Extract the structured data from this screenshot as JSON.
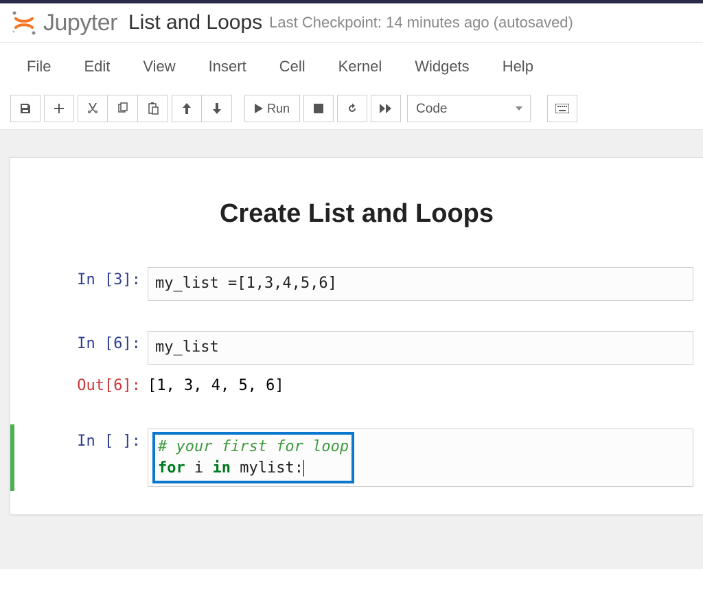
{
  "header": {
    "logo_text": "Jupyter",
    "notebook_title": "List and Loops",
    "checkpoint": "Last Checkpoint: 14 minutes ago  (autosaved)"
  },
  "menubar": {
    "items": [
      "File",
      "Edit",
      "View",
      "Insert",
      "Cell",
      "Kernel",
      "Widgets",
      "Help"
    ]
  },
  "toolbar": {
    "run_label": "Run",
    "celltype": "Code"
  },
  "content": {
    "heading": "Create List and Loops",
    "cell1": {
      "prompt": "In [3]:",
      "code": "my_list =[1,3,4,5,6]"
    },
    "cell2": {
      "prompt": "In [6]:",
      "code": "my_list",
      "out_prompt": "Out[6]:",
      "output": "[1, 3, 4, 5, 6]"
    },
    "cell3": {
      "prompt": "In [ ]:",
      "line1_comment": "# your first for loop",
      "line2_for": "for",
      "line2_i": " i ",
      "line2_in": "in",
      "line2_rest": " mylist:"
    }
  }
}
